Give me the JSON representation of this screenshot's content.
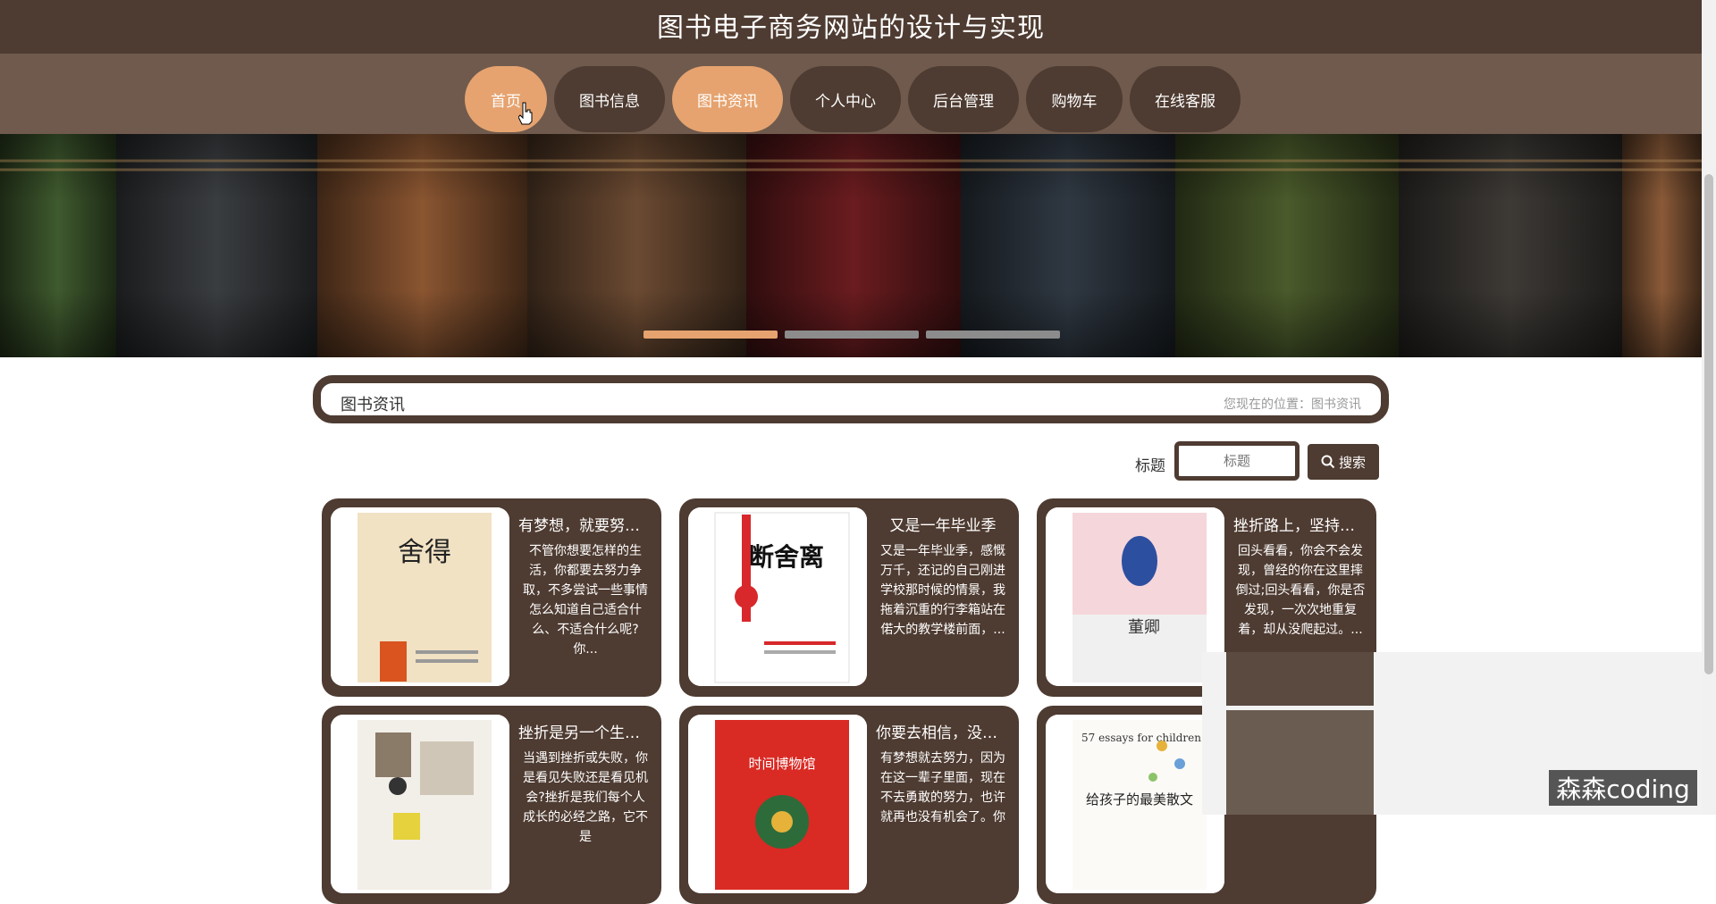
{
  "header": {
    "title": "图书电子商务网站的设计与实现"
  },
  "nav": {
    "items": [
      {
        "label": "首页",
        "active": true
      },
      {
        "label": "图书信息",
        "active": false
      },
      {
        "label": "图书资讯",
        "active": true
      },
      {
        "label": "个人中心",
        "active": false
      },
      {
        "label": "后台管理",
        "active": false
      },
      {
        "label": "购物车",
        "active": false
      },
      {
        "label": "在线客服",
        "active": false
      }
    ]
  },
  "banner": {
    "slides": 3,
    "active_slide": 1
  },
  "section": {
    "title": "图书资讯",
    "breadcrumb": "您现在的位置：图书资讯"
  },
  "search": {
    "label": "标题",
    "placeholder": "标题",
    "button_label": "搜索"
  },
  "cards": [
    {
      "title": "有梦想，就要努力...",
      "text": "不管你想要怎样的生活，你都要去努力争取，不多尝试一些事情怎么知道自己适合什么、不适合什么呢?你..."
    },
    {
      "title": "又是一年毕业季",
      "text": "又是一年毕业季，感慨万千，还记的自己刚进学校那时候的情景，我拖着沉重的行李箱站在偌大的教学楼前面，..."
    },
    {
      "title": "挫折路上，坚持常...",
      "text": "回头看看，你会不会发现，曾经的你在这里摔倒过;回头看看，你是否发现，一次次地重复着，却从没爬起过。..."
    },
    {
      "title": "挫折是另一个生命...",
      "text": "当遇到挫折或失败，你是看见失败还是看见机会?挫折是我们每个人成长的必经之路，它不是"
    },
    {
      "title": "你要去相信，没有...",
      "text": "有梦想就去努力，因为在这一辈子里面，现在不去勇敢的努力，也许就再也没有机会了。你"
    },
    {
      "title": "",
      "text": ""
    }
  ],
  "book_covers": [
    {
      "title": "舍得",
      "color": "#f1e2c4"
    },
    {
      "title": "断舍离",
      "color": "#ffffff"
    },
    {
      "title": "董卿",
      "color": "#f5d6db"
    },
    {
      "title": "",
      "color": "#f2efe8"
    },
    {
      "title": "时间博物馆",
      "color": "#d92a24"
    },
    {
      "title": "给孩子的最美散文",
      "subtitle": "57 essays for children",
      "color": "#fbfaf6"
    }
  ],
  "watermark": "森森coding",
  "colors": {
    "brown": "#4e3b31",
    "nav_bg": "#6f5a4d",
    "accent": "#e6a36f"
  }
}
